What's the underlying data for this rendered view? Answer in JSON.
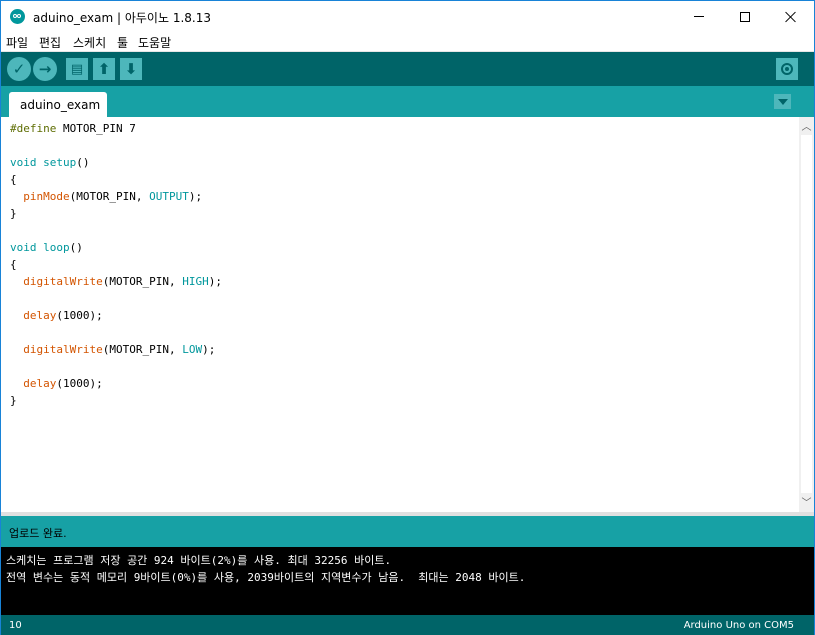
{
  "window": {
    "title": "aduino_exam | 아두이노 1.8.13"
  },
  "menu": [
    "파일",
    "편집",
    "스케치",
    "툴",
    "도움말"
  ],
  "toolbar": {
    "verify_icon": "check-icon",
    "upload_icon": "arrow-right-icon",
    "new_icon": "document-icon",
    "open_icon": "arrow-up-icon",
    "save_icon": "arrow-down-icon",
    "serial_icon": "magnifier-icon"
  },
  "tabs": [
    {
      "label": "aduino_exam"
    }
  ],
  "editor": {
    "lines": [
      [
        "#define",
        " MOTOR_PIN 7"
      ],
      [
        "void",
        " ",
        "setup",
        "()"
      ],
      [
        "{"
      ],
      [
        "  ",
        "pinMode",
        "(MOTOR_PIN, ",
        "OUTPUT",
        ");"
      ],
      [
        "}"
      ],
      [
        "void",
        " ",
        "loop",
        "()"
      ],
      [
        "{"
      ],
      [
        "  ",
        "digitalWrite",
        "(MOTOR_PIN, ",
        "HIGH",
        ");"
      ],
      [
        "  ",
        "delay",
        "(1000);"
      ],
      [
        "  ",
        "digitalWrite",
        "(MOTOR_PIN, ",
        "LOW",
        ");"
      ],
      [
        "  ",
        "delay",
        "(1000);"
      ],
      [
        "}"
      ]
    ]
  },
  "status": {
    "message": "업로드 완료."
  },
  "console": {
    "lines": [
      "스케치는 프로그램 저장 공간 924 바이트(2%)를 사용. 최대 32256 바이트.",
      "전역 변수는 동적 메모리 9바이트(0%)를 사용, 2039바이트의 지역변수가 남음.  최대는 2048 바이트."
    ]
  },
  "footer": {
    "line": "10",
    "board": "Arduino Uno on COM5"
  },
  "colors": {
    "toolbar": "#006468",
    "tabstrip": "#17a1a5",
    "button": "#4db7bb",
    "keyword_type": "#00979c",
    "keyword_function": "#d35400",
    "preprocessor": "#5e6d03"
  }
}
